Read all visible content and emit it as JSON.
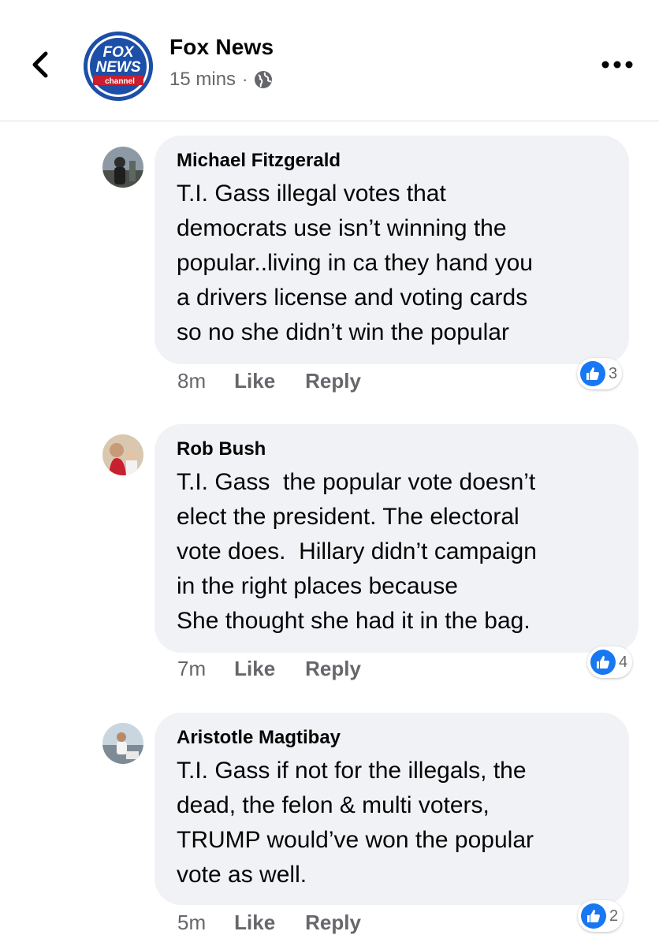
{
  "header": {
    "page_name": "Fox News",
    "time": "15 mins",
    "separator": "·",
    "logo_text": {
      "line1": "FOX",
      "line2": "NEWS",
      "line3": "channel"
    },
    "back_icon": "chevron-left-icon",
    "privacy_icon": "globe-icon",
    "more_icon": "more-horizontal-icon"
  },
  "comments": [
    {
      "author": "Michael Fitzgerald",
      "text": "T.I. Gass illegal votes that\ndemocrats use isn’t winning the\npopular..living in ca they hand you\na drivers license and voting cards\nso no she didn’t win the popular",
      "time": "8m",
      "like_label": "Like",
      "reply_label": "Reply",
      "reaction_count": "3"
    },
    {
      "author": "Rob Bush",
      "text": "T.I. Gass  the popular vote doesn’t\nelect the president. The electoral\nvote does.  Hillary didn’t campaign\nin the right places because\nShe thought she had it in the bag.",
      "time": "7m",
      "like_label": "Like",
      "reply_label": "Reply",
      "reaction_count": "4"
    },
    {
      "author": "Aristotle Magtibay",
      "text": "T.I. Gass if not for the illegals, the\ndead, the felon & multi voters,\nTRUMP would’ve won the popular\nvote as well.",
      "time": "5m",
      "like_label": "Like",
      "reply_label": "Reply",
      "reaction_count": "2"
    }
  ],
  "colors": {
    "accent": "#1877f2",
    "bubble": "#f0f2f5",
    "secondary_text": "#65676b",
    "fox_blue": "#1d4fa8",
    "fox_red": "#c8202f"
  }
}
